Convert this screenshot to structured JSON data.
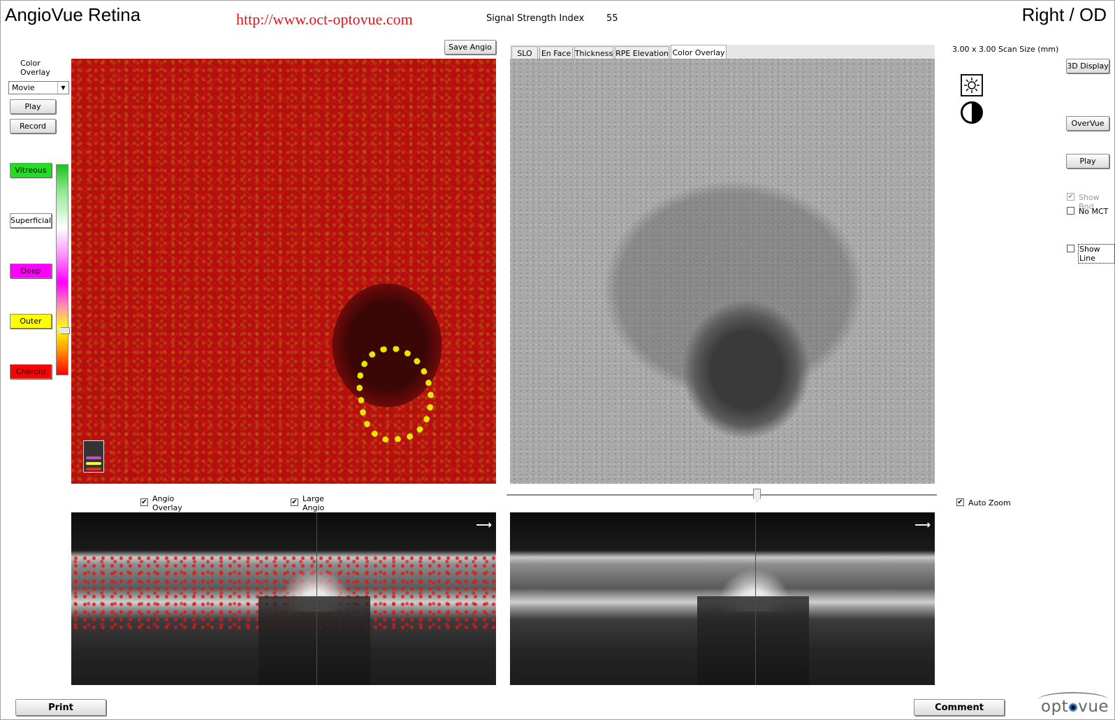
{
  "header": {
    "app_title": "AngioVue Retina",
    "url": "http://www.oct-optovue.com",
    "signal_label": "Signal Strength Index",
    "signal_value": "55",
    "eye_label": "Right / OD"
  },
  "left_panel": {
    "overlay_label_line1": "Color",
    "overlay_label_line2": "Overlay",
    "mode_select_value": "Movie",
    "play_label": "Play",
    "record_label": "Record",
    "layers": [
      {
        "label": "Vitreous",
        "color": "#22dd22"
      },
      {
        "label": "Superficial",
        "color": "#ffffff"
      },
      {
        "label": "Deep",
        "color": "#ff00ff"
      },
      {
        "label": "Outer",
        "color": "#ffff00"
      },
      {
        "label": "Choroid",
        "color": "#ff0000"
      }
    ]
  },
  "angio_panel": {
    "save_label": "Save Angio"
  },
  "enface_panel": {
    "tabs": [
      {
        "label": "SLO",
        "active": false
      },
      {
        "label": "En Face",
        "active": false
      },
      {
        "label": "Thickness",
        "active": false
      },
      {
        "label": "RPE Elevation",
        "active": false
      },
      {
        "label": "Color Overlay",
        "active": true
      }
    ]
  },
  "right_panel": {
    "scan_size": "3.00 x 3.00 Scan Size (mm)",
    "btn_3d": "3D Display",
    "btn_overvue": "OverVue",
    "btn_play": "Play",
    "show_bnd_label": "Show Bnd",
    "show_bnd_checked": true,
    "no_mct_label": "No MCT",
    "no_mct_checked": false,
    "show_line_label": "Show Line",
    "show_line_checked": false,
    "auto_zoom_label": "Auto Zoom",
    "auto_zoom_checked": true
  },
  "bscan_controls": {
    "angio_overlay_line1": "Angio",
    "angio_overlay_line2": "Overlay",
    "angio_overlay_checked": true,
    "large_angio_line1": "Large",
    "large_angio_line2": "Angio",
    "large_angio_checked": true
  },
  "footer": {
    "print_label": "Print",
    "comment_label": "Comment",
    "logo_text_pre": "opt",
    "logo_text_post": "vue"
  },
  "icons": {
    "brightness": "sun-icon",
    "contrast": "contrast-icon",
    "arrow": "right-arrow-icon"
  }
}
